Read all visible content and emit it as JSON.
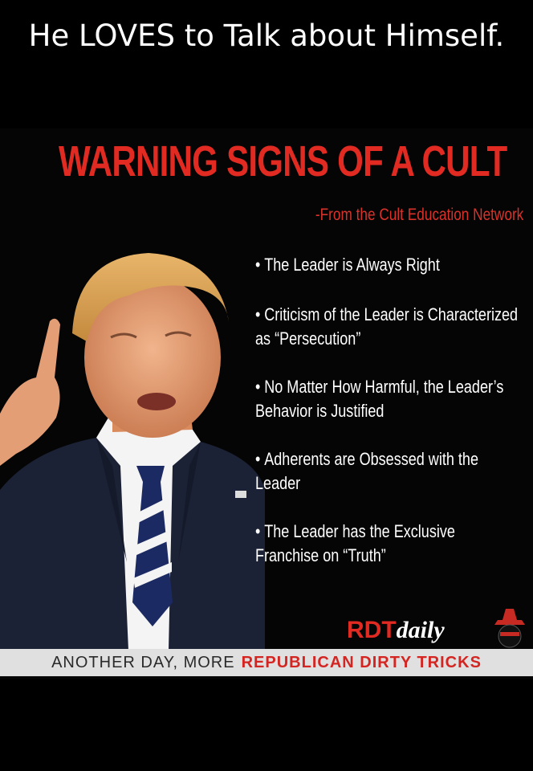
{
  "caption": "He LOVES to Talk about Himself.",
  "poster": {
    "headline": "WARNING SIGNS OF A CULT",
    "source": "-From the Cult Education Network",
    "signs": [
      "The Leader is Always Right",
      "Criticism of the Leader is Characterized as “Persecution”",
      "No Matter How Harmful, the Leader’s Behavior is Justified",
      "Adherents are Obsessed with the Leader",
      "The Leader has the Exclusive Franchise on “Truth”"
    ],
    "bullet": "•",
    "logo": {
      "part1": "RDT",
      "part2": "daily"
    },
    "banner": {
      "normal": "ANOTHER DAY, MORE",
      "strong": "REPUBLICAN DIRTY TRICKS"
    }
  },
  "colors": {
    "accent": "#e12a22",
    "background": "#050505",
    "banner": "#e0e0e0"
  }
}
